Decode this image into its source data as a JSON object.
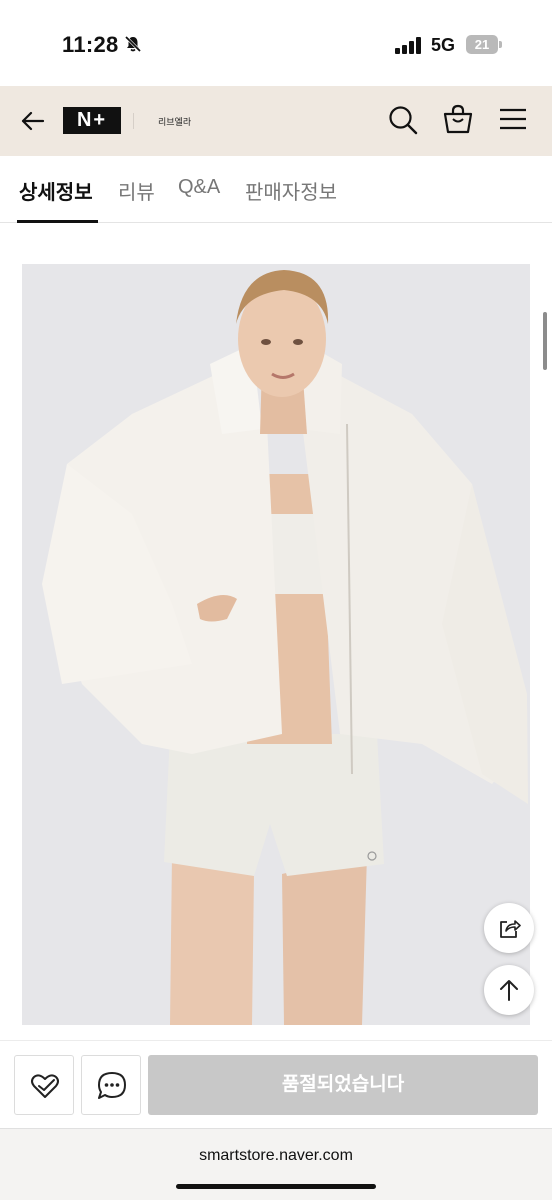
{
  "status_bar": {
    "time": "11:28",
    "network": "5G",
    "battery": "21"
  },
  "header": {
    "logo_text": "N+",
    "store_name": "리브엘라"
  },
  "tabs": [
    {
      "label": "상세정보",
      "active": true
    },
    {
      "label": "리뷰",
      "active": false
    },
    {
      "label": "Q&A",
      "active": false
    },
    {
      "label": "판매자정보",
      "active": false
    }
  ],
  "product": {
    "image_icon": "product-photo-white-sherpa-puffer-jacket"
  },
  "bottom_bar": {
    "soldout_label": "품절되었습니다"
  },
  "browser": {
    "url": "smartstore.naver.com"
  },
  "colors": {
    "header_bg": "#efe8e0",
    "soldout_bg": "#c8c8c8",
    "image_bg": "#e6e6e9"
  }
}
